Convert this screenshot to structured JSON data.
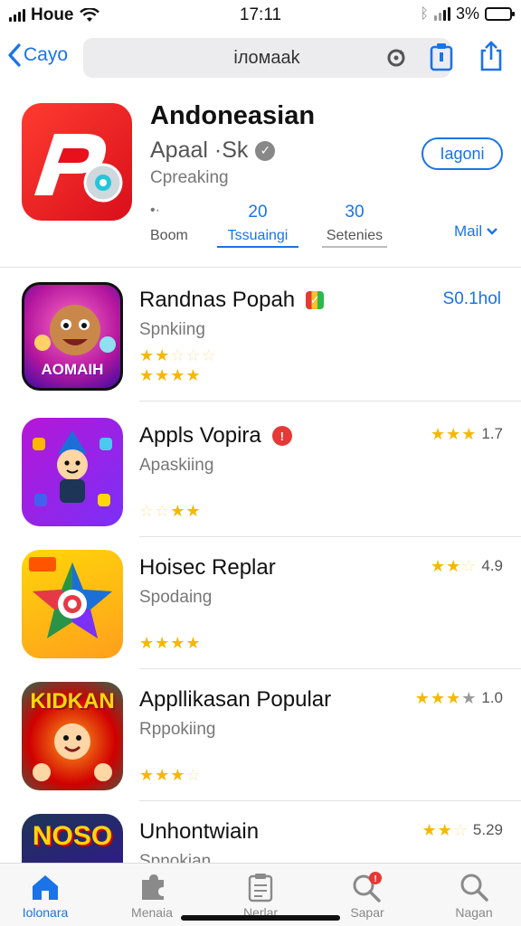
{
  "status_bar": {
    "carrier": "Houe",
    "time": "17:11",
    "battery": "3%"
  },
  "nav": {
    "back_label": "Cayo",
    "url": "iлoмaak"
  },
  "featured": {
    "title": "Andoneasian",
    "subtitle": "Apaal ·Sk",
    "developer": "Cpreaking",
    "get_label": "Iagoni",
    "stats": [
      {
        "value": "",
        "label": "Boom"
      },
      {
        "value": "20",
        "label": "Tssuaingi"
      },
      {
        "value": "30",
        "label": "Setenies"
      }
    ],
    "more_label": "Mail"
  },
  "apps": [
    {
      "name": "Randnas Popah",
      "developer": "Spnkiing",
      "price": "S0.1hol",
      "rating": "",
      "badge_color": "#2db84d",
      "stars_top": 2.5,
      "stars_bottom": 4,
      "icon_text": "AOMAIH"
    },
    {
      "name": "Appls Vopira",
      "developer": "Apaskiing",
      "price": "",
      "rating": "1.7",
      "badge_color": "#e53935",
      "stars_top": null,
      "stars_bottom": 3,
      "icon_text": ""
    },
    {
      "name": "Hoisec Replar",
      "developer": "Spodaing",
      "price": "",
      "rating": "4.9",
      "badge_color": null,
      "stars_top": null,
      "stars_bottom": 4,
      "icon_text": ""
    },
    {
      "name": "Appllikasan Popular",
      "developer": "Rppokiing",
      "price": "",
      "rating": "1.0",
      "badge_color": null,
      "stars_top": null,
      "stars_bottom": 3.5,
      "icon_text": "KIDKAN"
    },
    {
      "name": "Unhontwiain",
      "developer": "Spnokian",
      "price": "",
      "rating": "5.29",
      "badge_color": null,
      "stars_top": null,
      "stars_bottom": null,
      "icon_text": "NOSO"
    }
  ],
  "tabs": [
    {
      "label": "Iolonara",
      "icon": "home-icon"
    },
    {
      "label": "Menaia",
      "icon": "puzzle-icon"
    },
    {
      "label": "Nerlar",
      "icon": "clipboard-icon"
    },
    {
      "label": "Sapar",
      "icon": "search-badge-icon"
    },
    {
      "label": "Nagan",
      "icon": "search-icon"
    }
  ],
  "colors": {
    "accent": "#1a73e8",
    "star": "#f5b800",
    "featured_icon": "#e8101b"
  }
}
